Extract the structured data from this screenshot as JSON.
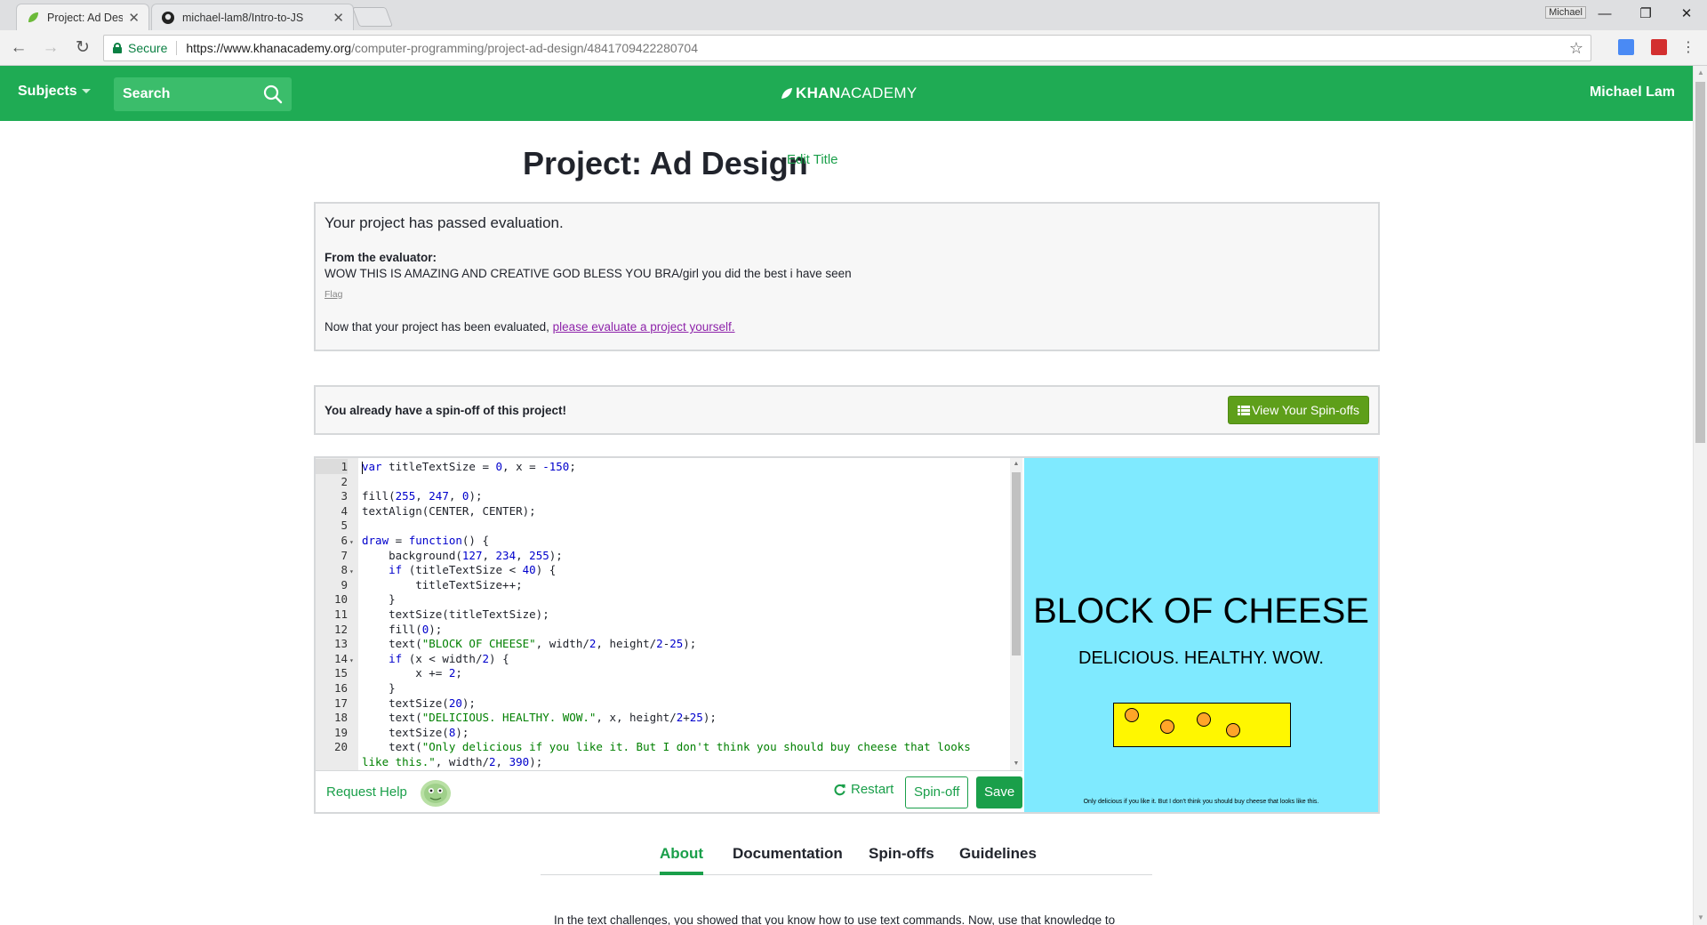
{
  "browser": {
    "tabs": [
      {
        "title": "Project: Ad Design | Com",
        "active": true
      },
      {
        "title": "michael-lam8/Intro-to-JS",
        "active": false
      }
    ],
    "window_user": "Michael",
    "secure_label": "Secure",
    "url_host": "https://www.khanacademy.org",
    "url_path": "/computer-programming/project-ad-design/4841709422280704"
  },
  "header": {
    "subjects": "Subjects",
    "search_label": "Search",
    "logo_khan": "KHAN",
    "logo_academy": "ACADEMY",
    "user": "Michael Lam",
    "bg_color": "#1fab54"
  },
  "project": {
    "title": "Project: Ad Design",
    "edit_title": "Edit Title"
  },
  "evaluation": {
    "passed": "Your project has passed evaluation.",
    "from_label": "From the evaluator:",
    "message": "WOW THIS IS AMAZING AND CREATIVE GOD BLESS YOU BRA/girl you did the best i have seen",
    "flag": "Flag",
    "now_text": "Now that your project has been evaluated, ",
    "now_link": "please evaluate a project yourself."
  },
  "spinoff_notice": {
    "message": "You already have a spin-off of this project!",
    "button": "View Your Spin-offs"
  },
  "editor": {
    "lines": [
      {
        "n": "1",
        "fold": "",
        "html": "<span class=\"cursor\"></span><span class=\"kw\">var</span> titleTextSize = <span class=\"num\">0</span>, x = <span class=\"num\">-150</span>;"
      },
      {
        "n": "2",
        "fold": "",
        "html": ""
      },
      {
        "n": "3",
        "fold": "",
        "html": "fill(<span class=\"num\">255</span>, <span class=\"num\">247</span>, <span class=\"num\">0</span>);"
      },
      {
        "n": "4",
        "fold": "",
        "html": "textAlign(CENTER, CENTER);"
      },
      {
        "n": "5",
        "fold": "",
        "html": ""
      },
      {
        "n": "6",
        "fold": "▾",
        "html": "<span class=\"kw\">draw</span> = <span class=\"kw\">function</span>() {"
      },
      {
        "n": "7",
        "fold": "",
        "html": "    background(<span class=\"num\">127</span>, <span class=\"num\">234</span>, <span class=\"num\">255</span>);"
      },
      {
        "n": "8",
        "fold": "▾",
        "html": "    <span class=\"kw\">if</span> (titleTextSize &lt; <span class=\"num\">40</span>) {"
      },
      {
        "n": "9",
        "fold": "",
        "html": "        titleTextSize++;"
      },
      {
        "n": "10",
        "fold": "",
        "html": "    }"
      },
      {
        "n": "11",
        "fold": "",
        "html": "    textSize(titleTextSize);"
      },
      {
        "n": "12",
        "fold": "",
        "html": "    fill(<span class=\"num\">0</span>);"
      },
      {
        "n": "13",
        "fold": "",
        "html": "    text(<span class=\"str\">\"BLOCK OF CHEESE\"</span>, width/<span class=\"num\">2</span>, height/<span class=\"num\">2</span>-<span class=\"num\">25</span>);"
      },
      {
        "n": "14",
        "fold": "▾",
        "html": "    <span class=\"kw\">if</span> (x &lt; width/<span class=\"num\">2</span>) {"
      },
      {
        "n": "15",
        "fold": "",
        "html": "        x += <span class=\"num\">2</span>;"
      },
      {
        "n": "16",
        "fold": "",
        "html": "    }"
      },
      {
        "n": "17",
        "fold": "",
        "html": "    textSize(<span class=\"num\">20</span>);"
      },
      {
        "n": "18",
        "fold": "",
        "html": "    text(<span class=\"str\">\"DELICIOUS. HEALTHY. WOW.\"</span>, x, height/<span class=\"num\">2</span>+<span class=\"num\">25</span>);"
      },
      {
        "n": "19",
        "fold": "",
        "html": "    textSize(<span class=\"num\">8</span>);"
      },
      {
        "n": "20",
        "fold": "",
        "html": "    text(<span class=\"str\">\"Only delicious if you like it. But I don't think you should buy cheese that looks</span>"
      },
      {
        "n": "",
        "fold": "",
        "html": "<span class=\"str\">like this.\"</span>, width/<span class=\"num\">2</span>, <span class=\"num\">390</span>);"
      }
    ],
    "request_help": "Request Help",
    "restart": "Restart",
    "spinoff": "Spin-off",
    "save": "Save"
  },
  "canvas": {
    "bg_color": "#7feaff",
    "title": "BLOCK OF CHEESE",
    "subtitle": "DELICIOUS. HEALTHY. WOW.",
    "fine_print": "Only delicious if you like it. But I don't think you should buy cheese that looks like this.",
    "cheese_color": "#fff700",
    "hole_color": "#ffa528"
  },
  "page_tabs": [
    "About",
    "Documentation",
    "Spin-offs",
    "Guidelines"
  ],
  "about_text": "In the text challenges, you showed that you know how to use text commands. Now, use that knowledge to"
}
